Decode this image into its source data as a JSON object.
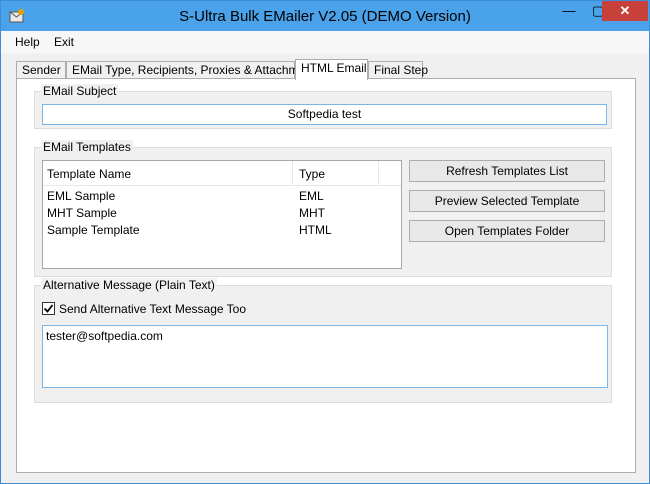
{
  "window": {
    "title": "S-Ultra Bulk EMailer V2.05 (DEMO Version)",
    "min_label": "—",
    "max_label": "▢",
    "close_label": "✕"
  },
  "menu": {
    "items": [
      "Help",
      "Exit"
    ]
  },
  "tabs": [
    {
      "label": "Sender",
      "active": false
    },
    {
      "label": "EMail Type, Recipients, Proxies & Attachments",
      "active": false
    },
    {
      "label": "HTML Email",
      "active": true
    },
    {
      "label": "Final Step",
      "active": false
    }
  ],
  "subject_group": {
    "title": "EMail Subject",
    "value": "Softpedia test"
  },
  "templates_group": {
    "title": "EMail Templates",
    "columns": [
      "Template Name",
      "Type"
    ],
    "rows": [
      [
        "EML Sample",
        "EML"
      ],
      [
        "MHT Sample",
        "MHT"
      ],
      [
        "Sample Template",
        "HTML"
      ]
    ],
    "buttons": {
      "refresh": "Refresh Templates List",
      "preview": "Preview Selected Template",
      "open": "Open Templates Folder"
    }
  },
  "alt_group": {
    "title": "Alternative Message (Plain Text)",
    "checkbox_label": "Send Alternative Text Message Too",
    "checked": true,
    "text": "tester@softpedia.com"
  },
  "colors": {
    "titlebar": "#4aa3ea",
    "close": "#c7403a",
    "textbox_border": "#7ab6e8"
  }
}
